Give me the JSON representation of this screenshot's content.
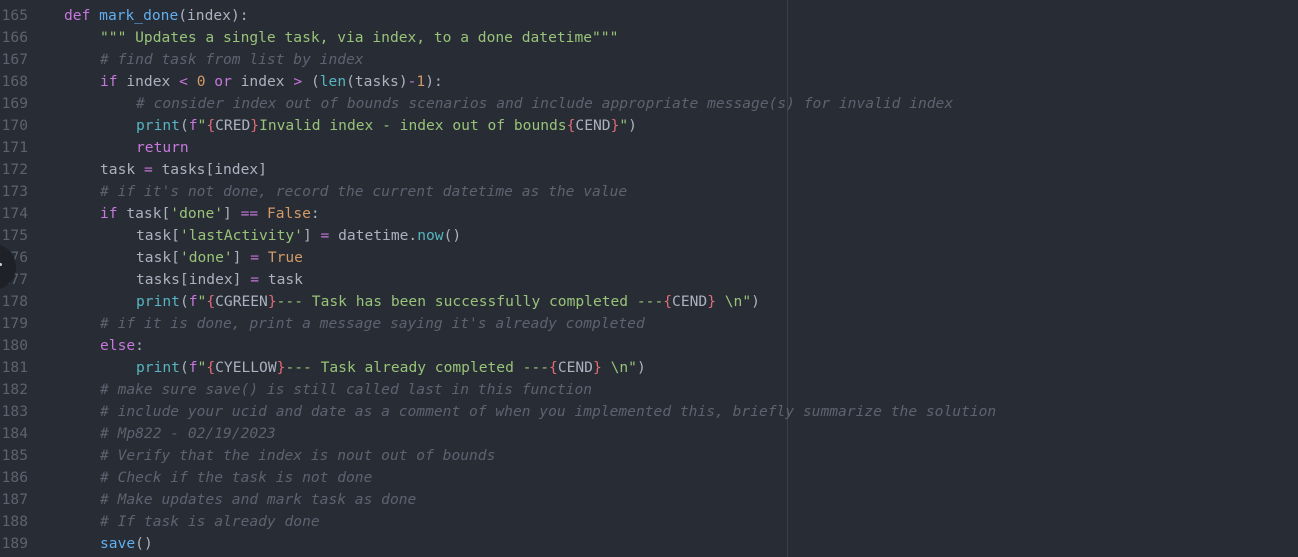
{
  "editor": {
    "lines": [
      {
        "n": "165",
        "indent": 0,
        "tokens": [
          [
            "kw",
            "def"
          ],
          [
            "pl",
            " "
          ],
          [
            "fn",
            "mark_done"
          ],
          [
            "pl",
            "(index):"
          ]
        ]
      },
      {
        "n": "166",
        "indent": 1,
        "tokens": [
          [
            "str",
            "\"\"\" Updates a single task, via index, to a done datetime\"\"\""
          ]
        ]
      },
      {
        "n": "167",
        "indent": 1,
        "tokens": [
          [
            "cm",
            "# find task from list by index"
          ]
        ]
      },
      {
        "n": "168",
        "indent": 1,
        "tokens": [
          [
            "kw",
            "if"
          ],
          [
            "pl",
            " index "
          ],
          [
            "op",
            "<"
          ],
          [
            "pl",
            " "
          ],
          [
            "num",
            "0"
          ],
          [
            "pl",
            " "
          ],
          [
            "kw",
            "or"
          ],
          [
            "pl",
            " index "
          ],
          [
            "op",
            ">"
          ],
          [
            "pl",
            " ("
          ],
          [
            "bi",
            "len"
          ],
          [
            "pl",
            "(tasks)"
          ],
          [
            "op",
            "-"
          ],
          [
            "num",
            "1"
          ],
          [
            "pl",
            "):"
          ]
        ]
      },
      {
        "n": "169",
        "indent": 2,
        "tokens": [
          [
            "cm",
            "# consider index out of bounds scenarios and include appropriate message(s) for invalid index"
          ]
        ]
      },
      {
        "n": "170",
        "indent": 2,
        "tokens": [
          [
            "bi",
            "print"
          ],
          [
            "pl",
            "("
          ],
          [
            "kw",
            "f"
          ],
          [
            "str",
            "\""
          ],
          [
            "br",
            "{"
          ],
          [
            "pl",
            "CRED"
          ],
          [
            "br",
            "}"
          ],
          [
            "str",
            "Invalid index - index out of bounds"
          ],
          [
            "br",
            "{"
          ],
          [
            "pl",
            "CEND"
          ],
          [
            "br",
            "}"
          ],
          [
            "str",
            "\""
          ],
          [
            "pl",
            ")"
          ]
        ]
      },
      {
        "n": "171",
        "indent": 2,
        "tokens": [
          [
            "kw",
            "return"
          ]
        ]
      },
      {
        "n": "172",
        "indent": 1,
        "tokens": [
          [
            "pl",
            "task "
          ],
          [
            "op",
            "="
          ],
          [
            "pl",
            " tasks[index]"
          ]
        ]
      },
      {
        "n": "173",
        "indent": 1,
        "tokens": [
          [
            "cm",
            "# if it's not done, record the current datetime as the value"
          ]
        ]
      },
      {
        "n": "174",
        "indent": 1,
        "tokens": [
          [
            "kw",
            "if"
          ],
          [
            "pl",
            " task["
          ],
          [
            "str",
            "'done'"
          ],
          [
            "pl",
            "] "
          ],
          [
            "op",
            "=="
          ],
          [
            "pl",
            " "
          ],
          [
            "num",
            "False"
          ],
          [
            "pl",
            ":"
          ]
        ]
      },
      {
        "n": "175",
        "indent": 2,
        "tokens": [
          [
            "pl",
            "task["
          ],
          [
            "str",
            "'lastActivity'"
          ],
          [
            "pl",
            "] "
          ],
          [
            "op",
            "="
          ],
          [
            "pl",
            " datetime."
          ],
          [
            "bi",
            "now"
          ],
          [
            "pl",
            "()"
          ]
        ]
      },
      {
        "n": "176",
        "indent": 2,
        "tokens": [
          [
            "pl",
            "task["
          ],
          [
            "str",
            "'done'"
          ],
          [
            "pl",
            "] "
          ],
          [
            "op",
            "="
          ],
          [
            "pl",
            " "
          ],
          [
            "num",
            "True"
          ]
        ]
      },
      {
        "n": "177",
        "indent": 2,
        "tokens": [
          [
            "pl",
            "tasks[index] "
          ],
          [
            "op",
            "="
          ],
          [
            "pl",
            " task"
          ]
        ]
      },
      {
        "n": "178",
        "indent": 2,
        "tokens": [
          [
            "bi",
            "print"
          ],
          [
            "pl",
            "("
          ],
          [
            "kw",
            "f"
          ],
          [
            "str",
            "\""
          ],
          [
            "br",
            "{"
          ],
          [
            "pl",
            "CGREEN"
          ],
          [
            "br",
            "}"
          ],
          [
            "str",
            "--- Task has been successfully completed ---"
          ],
          [
            "br",
            "{"
          ],
          [
            "pl",
            "CEND"
          ],
          [
            "br",
            "}"
          ],
          [
            "str",
            " \\n\""
          ],
          [
            "pl",
            ")"
          ]
        ]
      },
      {
        "n": "179",
        "indent": 1,
        "tokens": [
          [
            "cm",
            "# if it is done, print a message saying it's already completed"
          ]
        ]
      },
      {
        "n": "180",
        "indent": 1,
        "tokens": [
          [
            "kw",
            "else"
          ],
          [
            "pl",
            ":"
          ]
        ]
      },
      {
        "n": "181",
        "indent": 2,
        "tokens": [
          [
            "bi",
            "print"
          ],
          [
            "pl",
            "("
          ],
          [
            "kw",
            "f"
          ],
          [
            "str",
            "\""
          ],
          [
            "br",
            "{"
          ],
          [
            "pl",
            "CYELLOW"
          ],
          [
            "br",
            "}"
          ],
          [
            "str",
            "--- Task already completed ---"
          ],
          [
            "br",
            "{"
          ],
          [
            "pl",
            "CEND"
          ],
          [
            "br",
            "}"
          ],
          [
            "str",
            " \\n\""
          ],
          [
            "pl",
            ")"
          ]
        ]
      },
      {
        "n": "182",
        "indent": 1,
        "tokens": [
          [
            "cm",
            "# make sure save() is still called last in this function"
          ]
        ]
      },
      {
        "n": "183",
        "indent": 1,
        "tokens": [
          [
            "cm",
            "# include your ucid and date as a comment of when you implemented this, briefly summarize the solution"
          ]
        ]
      },
      {
        "n": "184",
        "indent": 1,
        "tokens": [
          [
            "cm",
            "# Mp822 - 02/19/2023"
          ]
        ]
      },
      {
        "n": "185",
        "indent": 1,
        "tokens": [
          [
            "cm",
            "# Verify that the index is nout out of bounds"
          ]
        ]
      },
      {
        "n": "186",
        "indent": 1,
        "tokens": [
          [
            "cm",
            "# Check if the task is not done"
          ]
        ]
      },
      {
        "n": "187",
        "indent": 1,
        "tokens": [
          [
            "cm",
            "# Make updates and mark task as done"
          ]
        ]
      },
      {
        "n": "188",
        "indent": 1,
        "tokens": [
          [
            "cm",
            "# If task is already done"
          ]
        ]
      },
      {
        "n": "189",
        "indent": 1,
        "tokens": [
          [
            "fn",
            "save"
          ],
          [
            "pl",
            "()"
          ]
        ]
      }
    ]
  }
}
